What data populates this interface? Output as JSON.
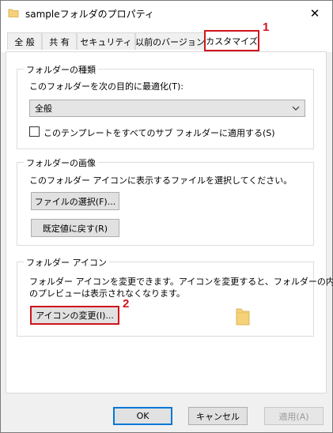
{
  "window": {
    "title": "sampleフォルダのプロパティ",
    "close_glyph": "✕"
  },
  "tabs": [
    {
      "label": "全 般"
    },
    {
      "label": "共 有"
    },
    {
      "label": "セキュリティ"
    },
    {
      "label": "以前のバージョン"
    },
    {
      "label": "カスタマイズ",
      "active": true
    }
  ],
  "annotations": {
    "badge1": "1",
    "badge2": "2"
  },
  "optimize": {
    "legend": "フォルダーの種類",
    "prompt": "このフォルダーを次の目的に最適化(T):",
    "selected": "全般",
    "apply_subfolders": "このテンプレートをすべてのサブ フォルダーに適用する(S)"
  },
  "picture": {
    "legend": "フォルダーの画像",
    "prompt": "このフォルダー アイコンに表示するファイルを選択してください。",
    "choose_file": "ファイルの選択(F)...",
    "restore_default": "既定値に戻す(R)"
  },
  "icon": {
    "legend": "フォルダー アイコン",
    "desc_line1": "フォルダー アイコンを変更できます。アイコンを変更すると、フォルダーの内容",
    "desc_line2": "のプレビューは表示されなくなります。",
    "change": "アイコンの変更(I)..."
  },
  "footer": {
    "ok": "OK",
    "cancel": "キャンセル",
    "apply": "適用(A)"
  },
  "colors": {
    "highlight": "#d0141c",
    "folder": "#f5d27a"
  },
  "icons": [
    "folder-icon",
    "close-icon",
    "chevron-down-icon"
  ]
}
